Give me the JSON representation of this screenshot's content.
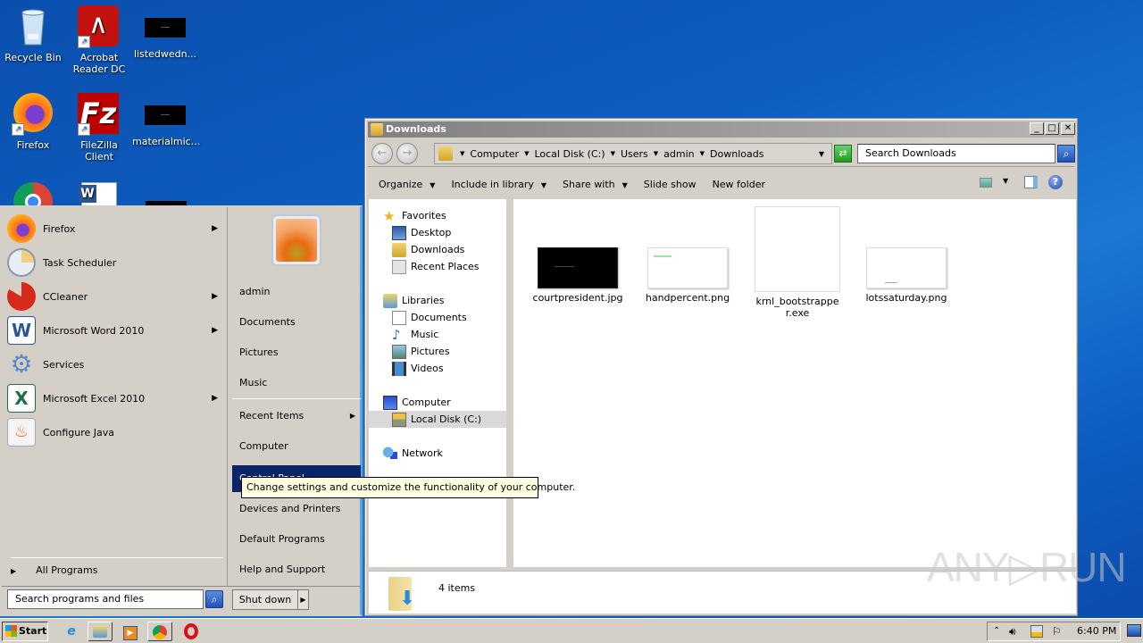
{
  "desktop": {
    "icons": [
      {
        "label": "Recycle Bin",
        "icon": "recycle-bin-icon"
      },
      {
        "label": "Acrobat Reader DC",
        "icon": "acrobat-icon"
      },
      {
        "label": "listedwedn...",
        "icon": "file-thumbnail-icon"
      },
      {
        "label": "Firefox",
        "icon": "firefox-icon"
      },
      {
        "label": "FileZilla Client",
        "icon": "filezilla-icon"
      },
      {
        "label": "materialmic...",
        "icon": "file-thumbnail-icon"
      },
      {
        "label": "",
        "icon": "chrome-icon"
      },
      {
        "label": "",
        "icon": "word-document-icon"
      }
    ]
  },
  "start_menu": {
    "programs": [
      {
        "label": "Firefox",
        "has_submenu": true
      },
      {
        "label": "Task Scheduler",
        "has_submenu": false
      },
      {
        "label": "CCleaner",
        "has_submenu": true
      },
      {
        "label": "Microsoft Word 2010",
        "has_submenu": true
      },
      {
        "label": "Services",
        "has_submenu": false
      },
      {
        "label": "Microsoft Excel 2010",
        "has_submenu": true
      },
      {
        "label": "Configure Java",
        "has_submenu": false
      }
    ],
    "all_programs": "All Programs",
    "search_placeholder": "Search programs and files",
    "right_items": [
      {
        "label": "admin"
      },
      {
        "label": "Documents"
      },
      {
        "label": "Pictures"
      },
      {
        "label": "Music"
      },
      {
        "label": "Recent Items",
        "has_submenu": true
      },
      {
        "label": "Computer"
      },
      {
        "label": "Control Panel",
        "highlighted": true
      },
      {
        "label": "Devices and Printers"
      },
      {
        "label": "Default Programs"
      },
      {
        "label": "Help and Support"
      }
    ],
    "shutdown_label": "Shut down",
    "tooltip": "Change settings and customize the functionality of your computer."
  },
  "explorer": {
    "title": "Downloads",
    "breadcrumb": [
      "Computer",
      "Local Disk (C:)",
      "Users",
      "admin",
      "Downloads"
    ],
    "search_placeholder": "Search Downloads",
    "commands": [
      {
        "label": "Organize",
        "dropdown": true
      },
      {
        "label": "Include in library",
        "dropdown": true
      },
      {
        "label": "Share with",
        "dropdown": true
      },
      {
        "label": "Slide show",
        "dropdown": false
      },
      {
        "label": "New folder",
        "dropdown": false
      }
    ],
    "nav": {
      "favorites": {
        "label": "Favorites",
        "items": [
          "Desktop",
          "Downloads",
          "Recent Places"
        ]
      },
      "libraries": {
        "label": "Libraries",
        "items": [
          "Documents",
          "Music",
          "Pictures",
          "Videos"
        ]
      },
      "computer": {
        "label": "Computer",
        "items": [
          "Local Disk (C:)"
        ]
      },
      "network": {
        "label": "Network"
      }
    },
    "selected_nav": "Local Disk (C:)",
    "files": [
      {
        "name": "courtpresident.jpg",
        "type": "image-black"
      },
      {
        "name": "handpercent.png",
        "type": "image-white"
      },
      {
        "name": "krnl_bootstrapper.exe",
        "type": "exe"
      },
      {
        "name": "lotssaturday.png",
        "type": "image-white"
      }
    ],
    "status": "4 items"
  },
  "taskbar": {
    "start_label": "Start",
    "clock": "6:40 PM",
    "pinned": [
      "internet-explorer",
      "windows-explorer",
      "media-player",
      "chrome",
      "opera"
    ]
  },
  "watermark": "ANY▷RUN",
  "colors": {
    "desktop_blue": "#0e5dbf",
    "highlight": "#0a246a",
    "tooltip_bg": "#ffffe1",
    "chrome_gray": "#d4d0c8"
  }
}
